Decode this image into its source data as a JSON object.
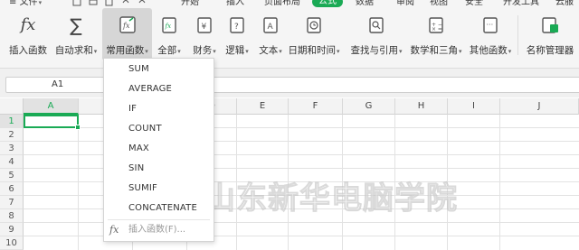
{
  "menubar": {
    "file_label": "文件",
    "tabs": [
      {
        "label": "开始"
      },
      {
        "label": "插入"
      },
      {
        "label": "页面布局"
      },
      {
        "label": "公式",
        "active": true
      },
      {
        "label": "数据"
      },
      {
        "label": "审阅"
      },
      {
        "label": "视图"
      },
      {
        "label": "安全"
      },
      {
        "label": "开发工具"
      },
      {
        "label": "云服"
      }
    ]
  },
  "ribbon": {
    "insert_function": "插入函数",
    "autosum": "自动求和",
    "common_functions": "常用函数",
    "all": "全部",
    "finance": "财务",
    "logic": "逻辑",
    "text": "文本",
    "datetime": "日期和时间",
    "lookup": "查找与引用",
    "math": "数学和三角",
    "other": "其他函数",
    "name_manager": "名称管理器",
    "insert_function_icon_text": "fx",
    "autosum_icon_text": "∑"
  },
  "formula_bar": {
    "name_box": "A1",
    "formula": ""
  },
  "grid": {
    "columns": [
      "A",
      "B",
      "C",
      "D",
      "E",
      "F",
      "G",
      "H",
      "I",
      "J"
    ],
    "rows": [
      "1",
      "2",
      "3",
      "4",
      "5",
      "6",
      "7",
      "8",
      "9",
      "10"
    ],
    "selected_cell": "A1"
  },
  "dropdown": {
    "items": [
      "SUM",
      "AVERAGE",
      "IF",
      "COUNT",
      "MAX",
      "SIN",
      "SUMIF",
      "CONCATENATE"
    ],
    "footer_icon": "fx",
    "footer_label": "插入函数(F)..."
  },
  "watermark": {
    "text": "山东新华电脑学院",
    "registered": "®"
  },
  "colors": {
    "accent": "#1aaa55",
    "ribbon_bg": "#f5f5f5",
    "active_button_bg": "#d6d6d6"
  }
}
